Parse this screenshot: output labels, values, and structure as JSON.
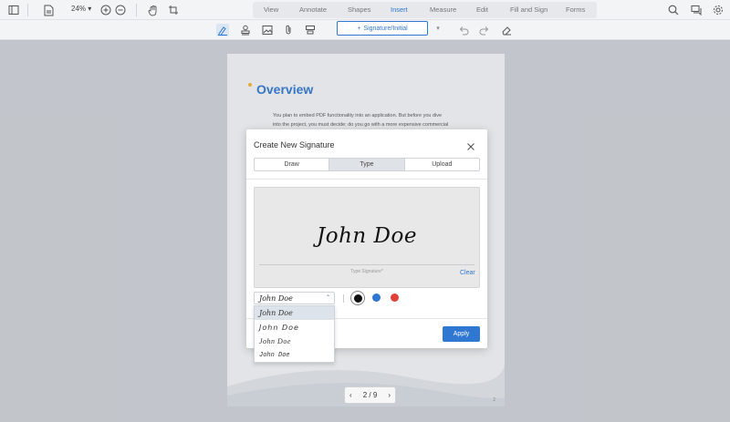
{
  "toolbar": {
    "zoom": "24%",
    "tabs": [
      "View",
      "Annotate",
      "Shapes",
      "Insert",
      "Measure",
      "Edit",
      "Fill and Sign",
      "Forms"
    ],
    "active_tab": "Insert"
  },
  "subtoolbar": {
    "signature_button": "Signature/Initial"
  },
  "document": {
    "heading": "Overview",
    "lines": [
      "You plan to embed PDF functionality into an application. But before you dive",
      "into the project, you must decide: do you go with a more expensive commercial"
    ],
    "page_corner": "2"
  },
  "pager": {
    "label": "2 / 9"
  },
  "modal": {
    "title": "Create New Signature",
    "tabs": [
      "Draw",
      "Type",
      "Upload"
    ],
    "active_tab": "Type",
    "signature": "John Doe",
    "hint": "Type Signature*",
    "clear": "Clear",
    "selected_font": "John Doe",
    "colors": [
      "#111111",
      "#2f77d1",
      "#e0403a"
    ],
    "selected_color": "#111111",
    "apply": "Apply"
  },
  "font_options": [
    "John Doe",
    "John Doe",
    "John Doe",
    "John Doe"
  ]
}
